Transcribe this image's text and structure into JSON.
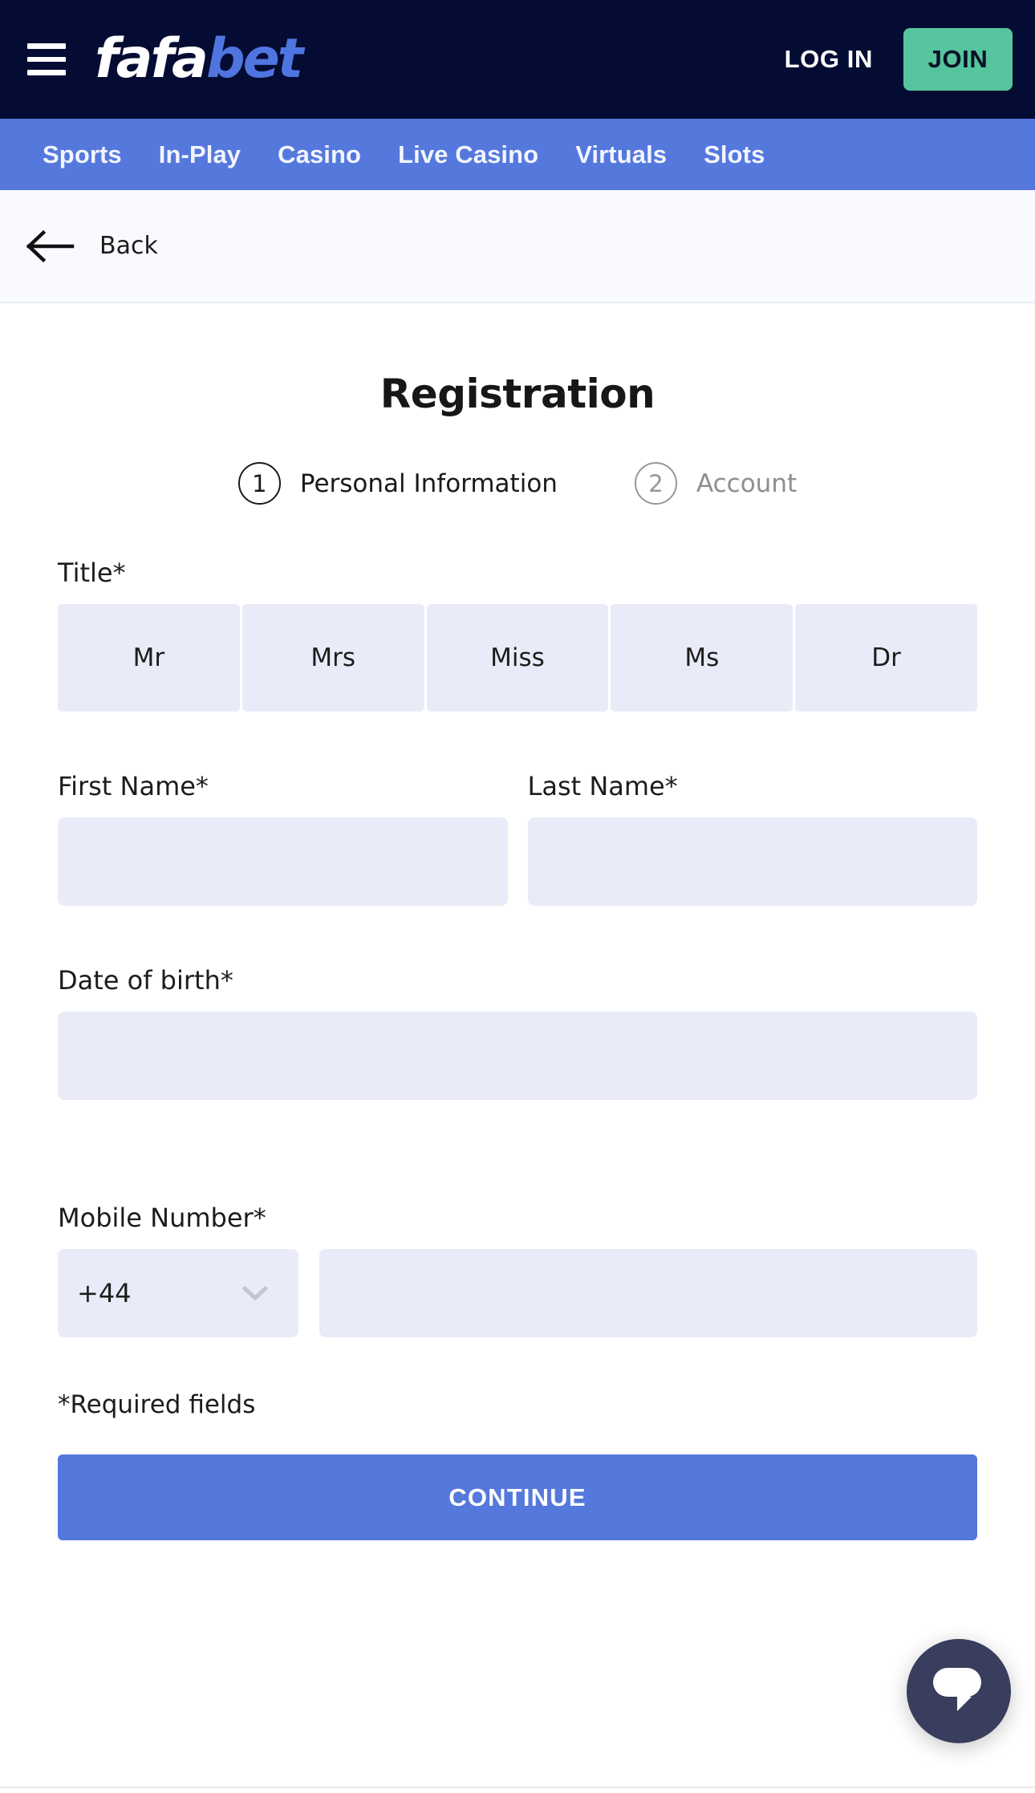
{
  "header": {
    "menu_icon": "hamburger-menu-icon",
    "logo": {
      "part1": "fafa",
      "part2": "bet"
    },
    "login_label": "LOG IN",
    "join_label": "JOIN",
    "bg_color": "#050c33",
    "join_color": "#56c49c"
  },
  "nav": {
    "bg_color": "#5578dd",
    "items": [
      {
        "label": "Sports"
      },
      {
        "label": "In-Play"
      },
      {
        "label": "Casino"
      },
      {
        "label": "Live Casino"
      },
      {
        "label": "Virtuals"
      },
      {
        "label": "Slots"
      }
    ]
  },
  "backbar": {
    "icon": "arrow-left-icon",
    "label": "Back"
  },
  "form": {
    "title": "Registration",
    "steps": [
      {
        "number": "1",
        "label": "Personal Information",
        "state": "active"
      },
      {
        "number": "2",
        "label": "Account",
        "state": "inactive"
      }
    ],
    "title_field": {
      "label": "Title*",
      "options": [
        "Mr",
        "Mrs",
        "Miss",
        "Ms",
        "Dr"
      ],
      "selected": ""
    },
    "first_name": {
      "label": "First Name*",
      "value": "",
      "placeholder": ""
    },
    "last_name": {
      "label": "Last Name*",
      "value": "",
      "placeholder": ""
    },
    "date_of_birth": {
      "label": "Date of birth*",
      "value": "",
      "placeholder": ""
    },
    "mobile": {
      "label": "Mobile Number*",
      "country_code": "+44",
      "chevron_icon": "chevron-down-icon",
      "number_value": "",
      "number_placeholder": ""
    },
    "required_note": "*Required fields",
    "continue_label": "CONTINUE",
    "field_bg_color": "#e9ebf8",
    "continue_color": "#5578dd"
  },
  "chat": {
    "icon": "chat-bubble-icon",
    "bg_color": "#393e5e"
  }
}
